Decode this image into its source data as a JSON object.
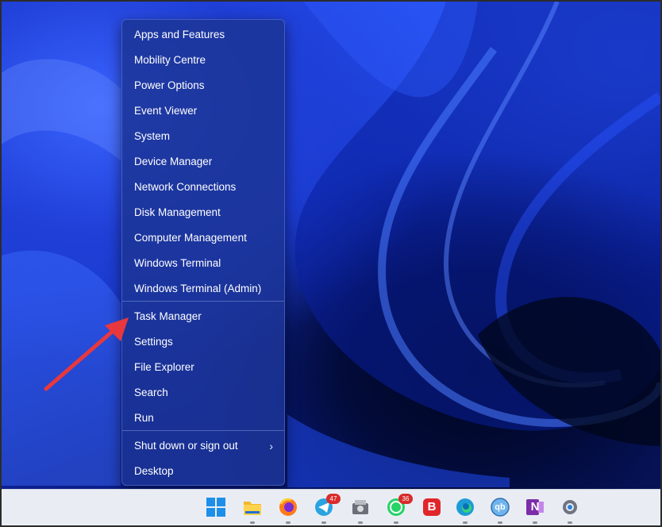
{
  "menu": {
    "items": [
      {
        "label": "Apps and Features"
      },
      {
        "label": "Mobility Centre"
      },
      {
        "label": "Power Options"
      },
      {
        "label": "Event Viewer"
      },
      {
        "label": "System"
      },
      {
        "label": "Device Manager"
      },
      {
        "label": "Network Connections"
      },
      {
        "label": "Disk Management"
      },
      {
        "label": "Computer Management"
      },
      {
        "label": "Windows Terminal"
      },
      {
        "label": "Windows Terminal (Admin)"
      },
      {
        "label": "Task Manager"
      },
      {
        "label": "Settings"
      },
      {
        "label": "File Explorer"
      },
      {
        "label": "Search"
      },
      {
        "label": "Run"
      },
      {
        "label": "Shut down or sign out"
      },
      {
        "label": "Desktop"
      }
    ],
    "submenu_chevron": "›"
  },
  "taskbar": {
    "icons": [
      {
        "name": "windows-start-icon"
      },
      {
        "name": "file-explorer-icon"
      },
      {
        "name": "firefox-icon"
      },
      {
        "name": "telegram-icon",
        "badge": "47"
      },
      {
        "name": "gallery-app-icon"
      },
      {
        "name": "whatsapp-icon",
        "badge": "36"
      },
      {
        "name": "brave-icon",
        "letter": "B"
      },
      {
        "name": "edge-icon"
      },
      {
        "name": "qbittorrent-icon",
        "letter": "qb"
      },
      {
        "name": "onenote-icon",
        "letter": "N"
      },
      {
        "name": "settings-icon"
      }
    ]
  },
  "colors": {
    "menu_bg": "#1c3496",
    "annotation_arrow": "#e8383d",
    "taskbar_bg": "#e9edf3"
  }
}
